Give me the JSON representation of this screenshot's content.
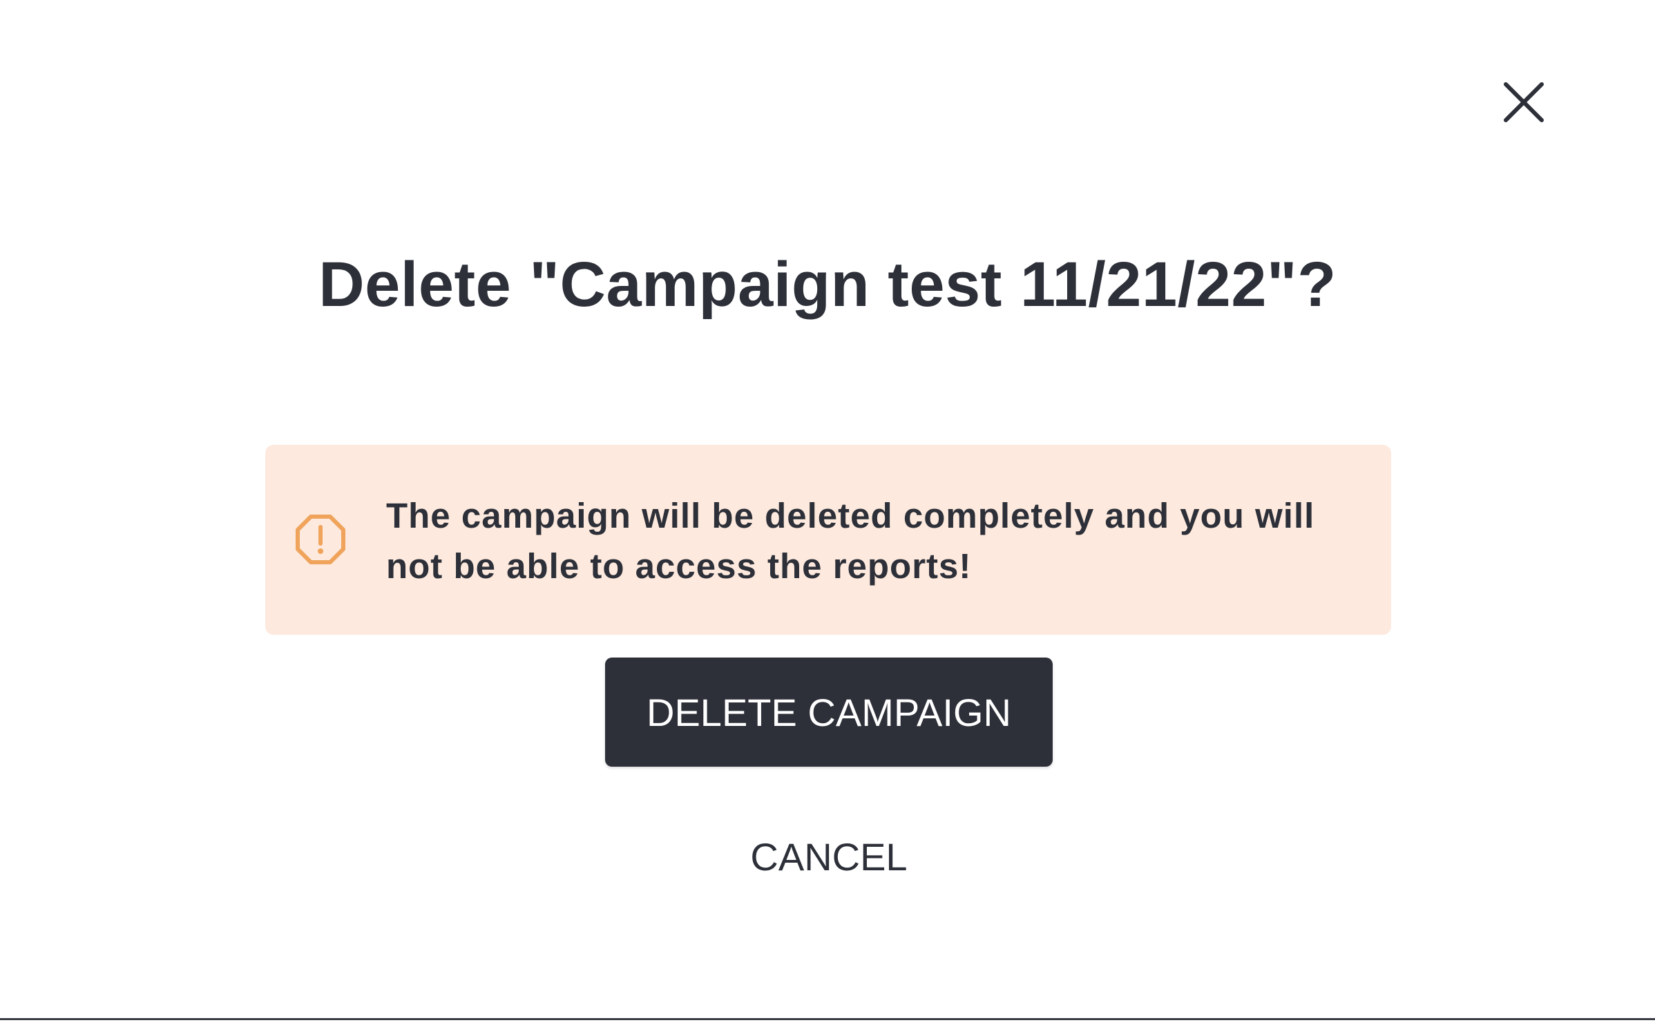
{
  "dialog": {
    "title": "Delete \"Campaign test 11/21/22\"?",
    "close_icon": "close-icon",
    "warning": {
      "icon": "warning-octagon-icon",
      "text": "The campaign will be deleted completely and you will not be able to access the reports!",
      "background_color": "#fde9dd",
      "icon_color": "#f0a35a"
    },
    "delete_label": "DELETE CAMPAIGN",
    "cancel_label": "CANCEL",
    "text_color": "#2d3039",
    "button_color": "#2d3039"
  }
}
